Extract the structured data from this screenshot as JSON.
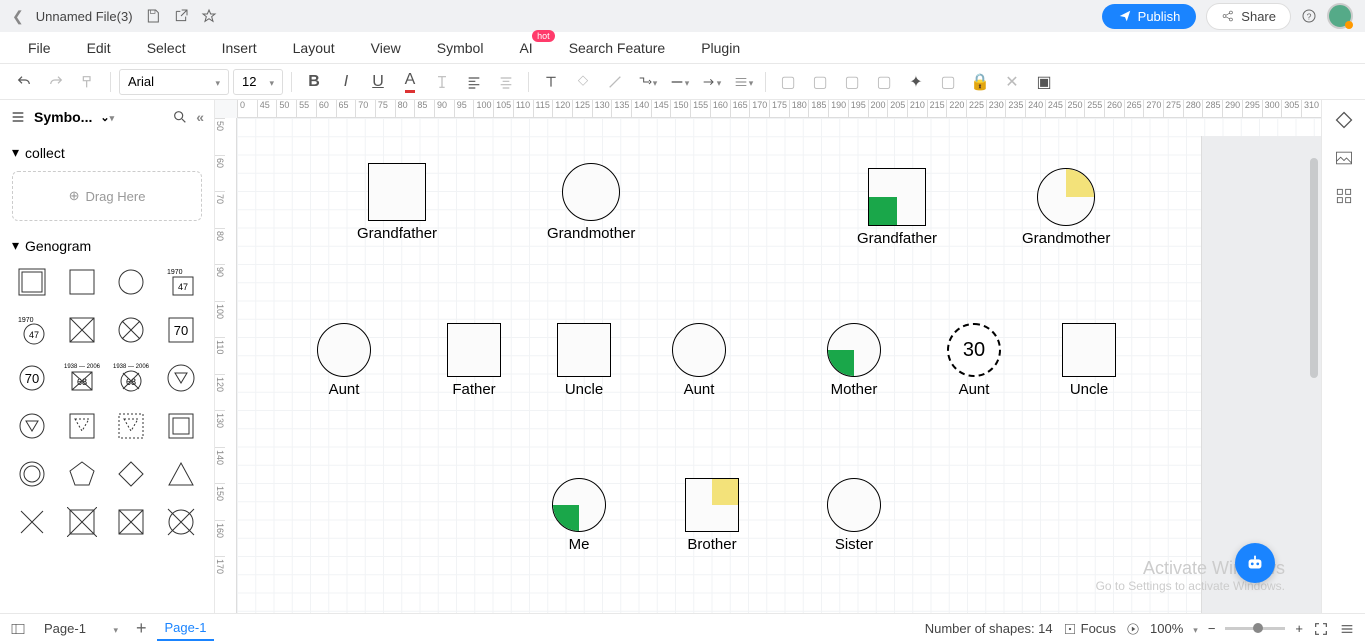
{
  "titlebar": {
    "filename": "Unnamed File(3)",
    "publish": "Publish",
    "share": "Share"
  },
  "menu": {
    "file": "File",
    "edit": "Edit",
    "select": "Select",
    "insert": "Insert",
    "layout": "Layout",
    "view": "View",
    "symbol": "Symbol",
    "ai": "AI",
    "ai_badge": "hot",
    "search": "Search Feature",
    "plugin": "Plugin"
  },
  "toolbar": {
    "font": "Arial",
    "size": "12"
  },
  "sidebar": {
    "title": "Symbo...",
    "collect": "collect",
    "drop": "Drag Here",
    "genogram": "Genogram"
  },
  "ruler_h": [
    "0",
    "45",
    "50",
    "55",
    "60",
    "65",
    "70",
    "75",
    "80",
    "85",
    "90",
    "95",
    "100",
    "105",
    "110",
    "115",
    "120",
    "125",
    "130",
    "135",
    "140",
    "145",
    "150",
    "155",
    "160",
    "165",
    "170",
    "175",
    "180",
    "185",
    "190",
    "195",
    "200",
    "205",
    "210",
    "215",
    "220",
    "225",
    "230",
    "235",
    "240",
    "245",
    "250",
    "255",
    "260",
    "265",
    "270",
    "275",
    "280",
    "285",
    "290",
    "295",
    "300",
    "305",
    "310"
  ],
  "ruler_v": [
    "50",
    "60",
    "70",
    "80",
    "90",
    "100",
    "110",
    "120",
    "130",
    "140",
    "150",
    "160",
    "170"
  ],
  "shapes": {
    "gf1": "Grandfather",
    "gm1": "Grandmother",
    "gf2": "Grandfather",
    "gm2": "Grandmother",
    "aunt1": "Aunt",
    "father": "Father",
    "uncle1": "Uncle",
    "aunt2": "Aunt",
    "mother": "Mother",
    "aunt3": "Aunt",
    "aunt3_age": "30",
    "uncle2": "Uncle",
    "me": "Me",
    "brother": "Brother",
    "sister": "Sister"
  },
  "status": {
    "page_sel": "Page-1",
    "page_tab": "Page-1",
    "shapes": "Number of shapes: 14",
    "focus": "Focus",
    "zoom": "100%"
  },
  "watermark": {
    "l1": "Activate Windows",
    "l2": "Go to Settings to activate Windows."
  },
  "sym_labels": {
    "y1970": "1970",
    "n47": "47",
    "n70": "70",
    "n68": "68"
  }
}
